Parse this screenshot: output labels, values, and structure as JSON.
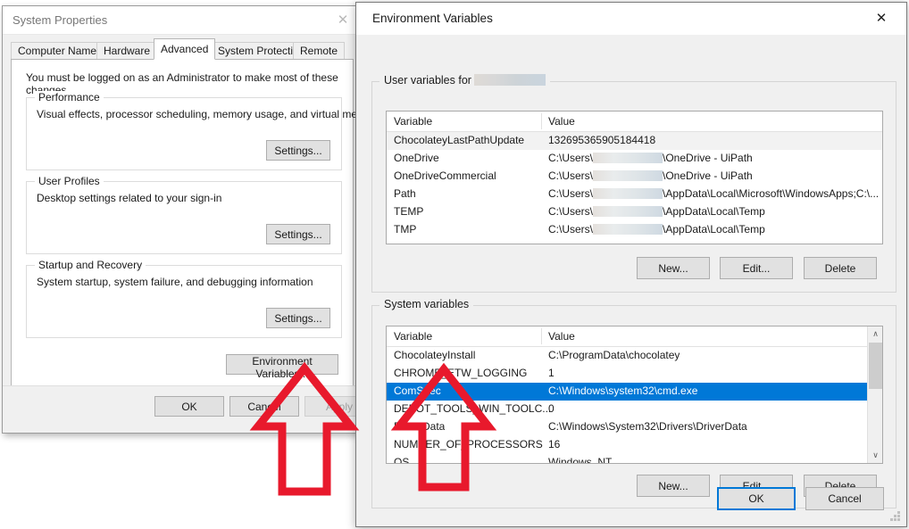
{
  "system_properties": {
    "title": "System Properties",
    "close_label": "✕",
    "tabs": [
      {
        "label": "Computer Name",
        "active": false
      },
      {
        "label": "Hardware",
        "active": false
      },
      {
        "label": "Advanced",
        "active": true
      },
      {
        "label": "System Protection",
        "active": false
      },
      {
        "label": "Remote",
        "active": false
      }
    ],
    "intro_text": "You must be logged on as an Administrator to make most of these changes.",
    "groups": [
      {
        "legend": "Performance",
        "description": "Visual effects, processor scheduling, memory usage, and virtual memory",
        "button": "Settings..."
      },
      {
        "legend": "User Profiles",
        "description": "Desktop settings related to your sign-in",
        "button": "Settings..."
      },
      {
        "legend": "Startup and Recovery",
        "description": "System startup, system failure, and debugging information",
        "button": "Settings..."
      }
    ],
    "env_vars_button": "Environment Variables...",
    "footer_buttons": [
      {
        "label": "OK",
        "disabled": false
      },
      {
        "label": "Cancel",
        "disabled": false
      },
      {
        "label": "Apply",
        "disabled": true
      }
    ]
  },
  "environment_variables": {
    "title": "Environment Variables",
    "close_label": "✕",
    "user_section": {
      "legend_prefix": "User variables for",
      "legend_username": "",
      "columns": [
        "Variable",
        "Value"
      ],
      "rows": [
        {
          "variable": "ChocolateyLastPathUpdate",
          "value": "132695365905184418",
          "redacted": false,
          "selected": false,
          "alt": true
        },
        {
          "variable": "OneDrive",
          "value_prefix": "C:\\Users\\",
          "value_suffix": "\\OneDrive - UiPath",
          "redacted": true,
          "selected": false,
          "alt": false
        },
        {
          "variable": "OneDriveCommercial",
          "value_prefix": "C:\\Users\\",
          "value_suffix": "\\OneDrive - UiPath",
          "redacted": true,
          "selected": false,
          "alt": false
        },
        {
          "variable": "Path",
          "value_prefix": "C:\\Users\\",
          "value_suffix": "\\AppData\\Local\\Microsoft\\WindowsApps;C:\\...",
          "redacted": true,
          "selected": false,
          "alt": false
        },
        {
          "variable": "TEMP",
          "value_prefix": "C:\\Users\\",
          "value_suffix": "\\AppData\\Local\\Temp",
          "redacted": true,
          "selected": false,
          "alt": false
        },
        {
          "variable": "TMP",
          "value_prefix": "C:\\Users\\",
          "value_suffix": "\\AppData\\Local\\Temp",
          "redacted": true,
          "selected": false,
          "alt": false
        }
      ],
      "buttons": [
        "New...",
        "Edit...",
        "Delete"
      ]
    },
    "system_section": {
      "legend": "System variables",
      "columns": [
        "Variable",
        "Value"
      ],
      "rows": [
        {
          "variable": "ChocolateyInstall",
          "value": "C:\\ProgramData\\chocolatey",
          "selected": false
        },
        {
          "variable": "CHROME_ETW_LOGGING",
          "value": "1",
          "selected": false
        },
        {
          "variable": "ComSpec",
          "value": "C:\\Windows\\system32\\cmd.exe",
          "selected": true
        },
        {
          "variable": "DEPOT_TOOLS_WIN_TOOLC...",
          "value": "0",
          "selected": false
        },
        {
          "variable": "DriverData",
          "value": "C:\\Windows\\System32\\Drivers\\DriverData",
          "selected": false
        },
        {
          "variable": "NUMBER_OF_PROCESSORS",
          "value": "16",
          "selected": false
        },
        {
          "variable": "OS",
          "value": "Windows_NT",
          "selected": false
        }
      ],
      "buttons": [
        "New...",
        "Edit...",
        "Delete"
      ],
      "scrollbar": {
        "up": "∧",
        "down": "∨"
      }
    },
    "footer_buttons": [
      {
        "label": "OK",
        "default": true
      },
      {
        "label": "Cancel",
        "default": false
      }
    ]
  },
  "annotations": {
    "arrow_color": "#E8192C",
    "arrows": [
      {
        "name": "arrow-pointing-environment-variables-button"
      },
      {
        "name": "arrow-pointing-system-variables-list"
      }
    ]
  }
}
